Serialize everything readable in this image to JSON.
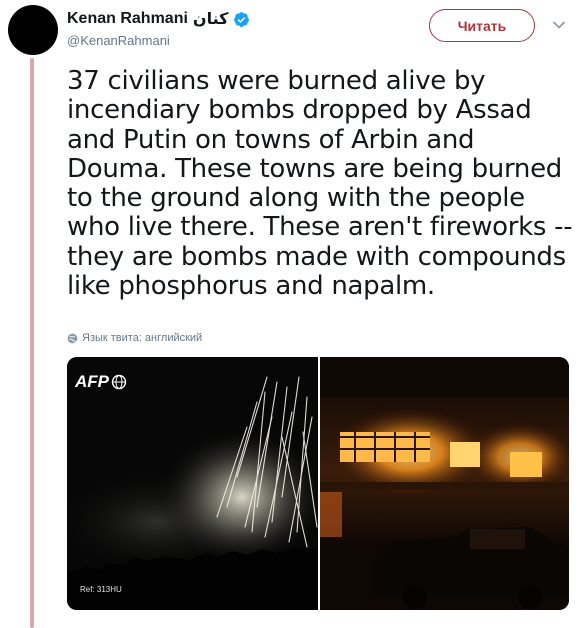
{
  "author": {
    "display_name": "Kenan Rahmani",
    "arabic_name": "كنان",
    "handle": "@KenanRahmani",
    "verified": true
  },
  "actions": {
    "follow_label": "Читать",
    "menu_icon": "chevron-down-icon"
  },
  "tweet": {
    "text": "37 civilians were burned alive by incendiary bombs dropped by Assad and Putin on towns of Arbin and Douma. These towns are being burned to the ground along with the people who live there. These aren't fireworks -- they are bombs made with compounds like phosphorus and napalm.",
    "language_note": "Язык твита: английский",
    "language_icon": "globe-icon"
  },
  "media": {
    "left_photo": {
      "logo_text": "AFP",
      "ref_text": "Ref: 313HU"
    },
    "right_photo": {}
  },
  "colors": {
    "accent": "#b0343c",
    "thread_line": "#d8a8a8",
    "verified": "#1da1f2",
    "secondary_text": "#657786"
  }
}
